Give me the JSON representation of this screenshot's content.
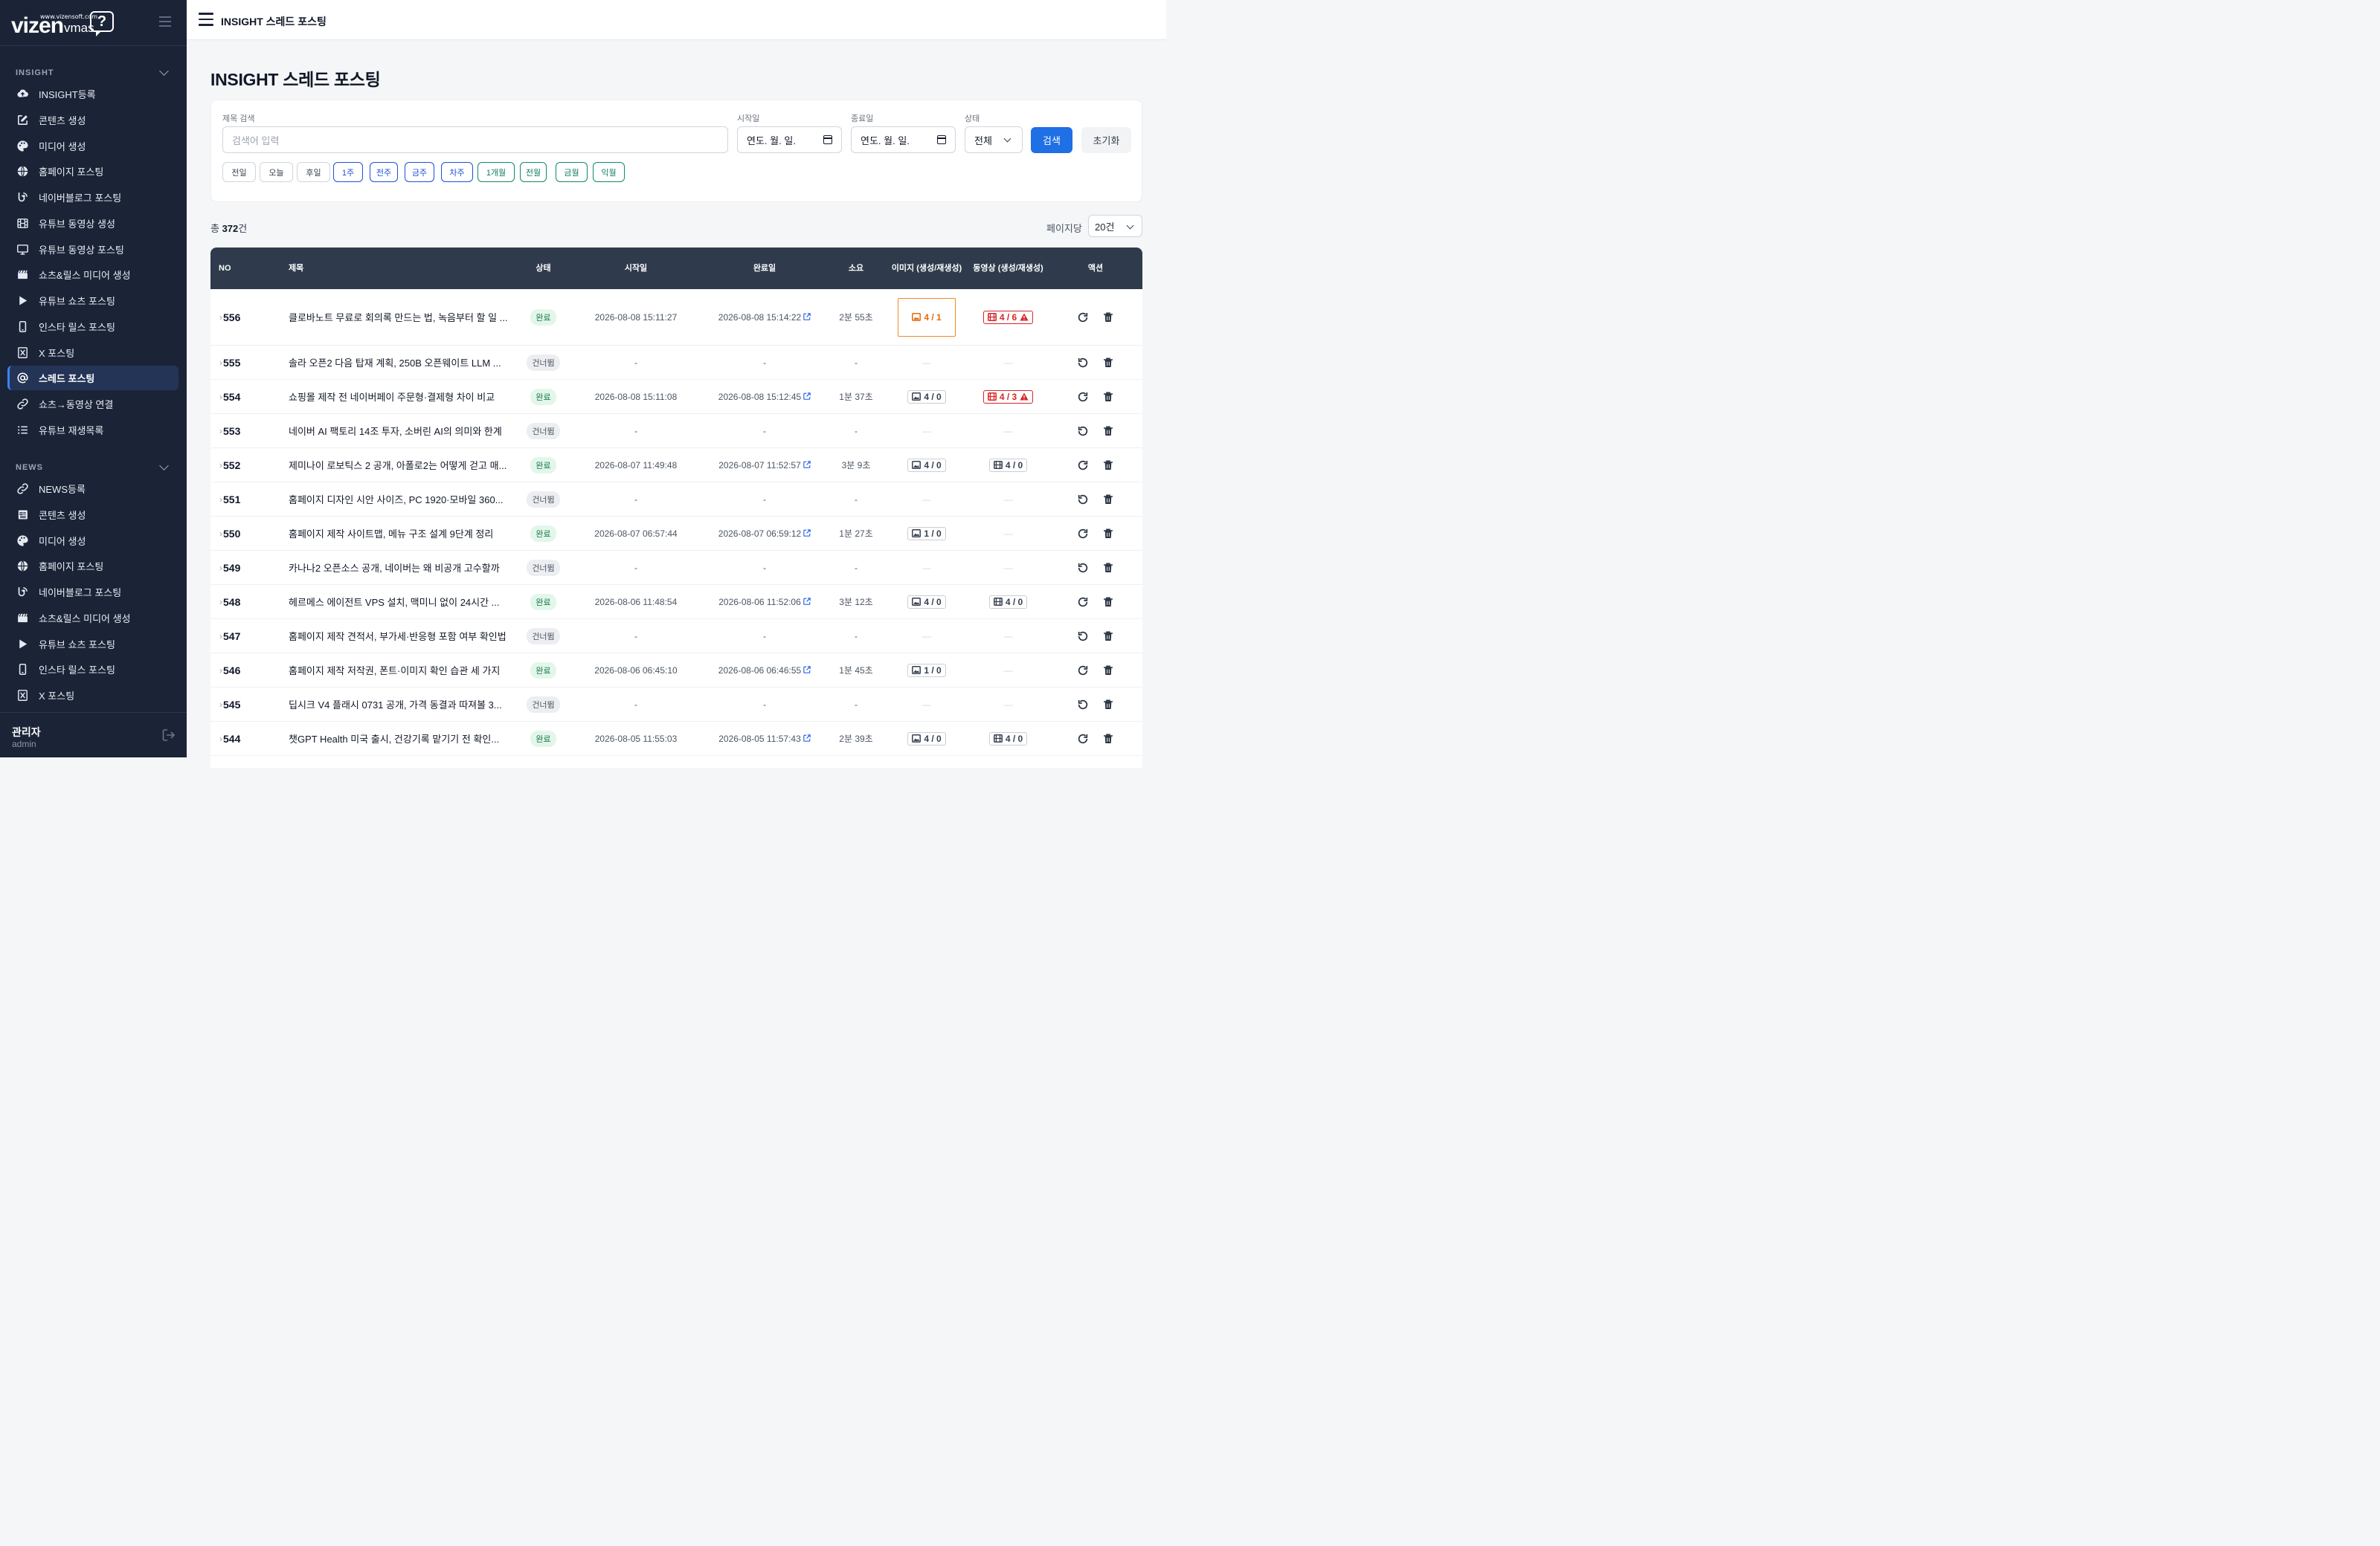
{
  "brand": {
    "url": "www.vizensoft.com",
    "name": "vizen",
    "product": "vmas",
    "mark": "?"
  },
  "sidebar": {
    "sections": [
      {
        "title": "INSIGHT",
        "items": [
          {
            "label": "INSIGHT등록",
            "icon": "cloud-upload-icon"
          },
          {
            "label": "콘텐츠 생성",
            "icon": "edit-icon"
          },
          {
            "label": "미디어 생성",
            "icon": "palette-icon"
          },
          {
            "label": "홈페이지 포스팅",
            "icon": "globe-icon"
          },
          {
            "label": "네이버블로그 포스팅",
            "icon": "blog-icon"
          },
          {
            "label": "유튜브 동영상 생성",
            "icon": "film-icon"
          },
          {
            "label": "유튜브 동영상 포스팅",
            "icon": "monitor-icon"
          },
          {
            "label": "쇼츠&릴스 미디어 생성",
            "icon": "clapper-icon"
          },
          {
            "label": "유튜브 쇼츠 포스팅",
            "icon": "play-icon"
          },
          {
            "label": "인스타 릴스 포스팅",
            "icon": "phone-icon"
          },
          {
            "label": "X 포스팅",
            "icon": "x-icon"
          },
          {
            "label": "스레드 포스팅",
            "icon": "at-icon",
            "active": true
          },
          {
            "label": "쇼츠→동영상 연결",
            "icon": "link-icon"
          },
          {
            "label": "유튜브 재생목록",
            "icon": "list-icon"
          }
        ]
      },
      {
        "title": "NEWS",
        "items": [
          {
            "label": "NEWS등록",
            "icon": "link-icon"
          },
          {
            "label": "콘텐츠 생성",
            "icon": "newspaper-icon"
          },
          {
            "label": "미디어 생성",
            "icon": "palette-icon"
          },
          {
            "label": "홈페이지 포스팅",
            "icon": "globe-icon"
          },
          {
            "label": "네이버블로그 포스팅",
            "icon": "blog-icon"
          },
          {
            "label": "쇼츠&릴스 미디어 생성",
            "icon": "clapper-icon"
          },
          {
            "label": "유튜브 쇼츠 포스팅",
            "icon": "play-icon"
          },
          {
            "label": "인스타 릴스 포스팅",
            "icon": "phone-icon"
          },
          {
            "label": "X 포스팅",
            "icon": "x-icon"
          }
        ]
      }
    ],
    "user": {
      "name": "관리자",
      "id": "admin"
    }
  },
  "topbar": {
    "title": "INSIGHT 스레드 포스팅"
  },
  "page": {
    "title": "INSIGHT 스레드 포스팅"
  },
  "filter": {
    "title_label": "제목 검색",
    "title_placeholder": "검색어 입력",
    "start_label": "시작일",
    "start_value": "연도. 월. 일.",
    "end_label": "종료일",
    "end_value": "연도. 월. 일.",
    "status_label": "상태",
    "status_value": "전체",
    "search_button": "검색",
    "reset_button": "초기화",
    "chips": [
      {
        "label": "전일",
        "style": "gray"
      },
      {
        "label": "오늘",
        "style": "gray"
      },
      {
        "label": "후일",
        "style": "gray"
      },
      {
        "label": "1주",
        "style": "blue"
      },
      {
        "label": "전주",
        "style": "blue"
      },
      {
        "label": "금주",
        "style": "blue"
      },
      {
        "label": "차주",
        "style": "blue"
      },
      {
        "label": "1개월",
        "style": "green"
      },
      {
        "label": "전월",
        "style": "green"
      },
      {
        "label": "금월",
        "style": "green"
      },
      {
        "label": "익월",
        "style": "green"
      }
    ]
  },
  "summary": {
    "prefix": "총 ",
    "count": "372",
    "suffix": "건",
    "per_page_label": "페이지당",
    "per_page_value": "20건"
  },
  "table": {
    "headers": [
      "NO",
      "제목",
      "상태",
      "시작일",
      "완료일",
      "소요",
      "이미지 (생성/재생성)",
      "동영상 (생성/재생성)",
      "액션"
    ],
    "rows": [
      {
        "no": "556",
        "title": "클로바노트 무료로 회의록 만드는 법, 녹음부터 할 일 ...",
        "status": "완료",
        "start": "2026-08-08 15:11:27",
        "end": "2026-08-08 15:14:22",
        "dur": "2분 55초",
        "img": "4 / 1",
        "img_style": "orange",
        "vid": "4 / 6",
        "vid_style": "red"
      },
      {
        "no": "555",
        "title": "솔라 오픈2 다음 탑재 계획, 250B 오픈웨이트 LLM ...",
        "status": "건너뜀",
        "start": "-",
        "end": "-",
        "dur": "-",
        "img": "—",
        "vid": "—"
      },
      {
        "no": "554",
        "title": "쇼핑몰 제작 전 네이버페이 주문형·결제형 차이 비교",
        "status": "완료",
        "start": "2026-08-08 15:11:08",
        "end": "2026-08-08 15:12:45",
        "dur": "1분 37초",
        "img": "4 / 0",
        "img_style": "normal",
        "vid": "4 / 3",
        "vid_style": "red"
      },
      {
        "no": "553",
        "title": "네이버 AI 팩토리 14조 투자, 소버린 AI의 의미와 한계",
        "status": "건너뜀",
        "start": "-",
        "end": "-",
        "dur": "-",
        "img": "—",
        "vid": "—"
      },
      {
        "no": "552",
        "title": "제미나이 로보틱스 2 공개, 아폴로2는 어떻게 걷고 매...",
        "status": "완료",
        "start": "2026-08-07 11:49:48",
        "end": "2026-08-07 11:52:57",
        "dur": "3분 9초",
        "img": "4 / 0",
        "img_style": "normal",
        "vid": "4 / 0",
        "vid_style": "normal"
      },
      {
        "no": "551",
        "title": "홈페이지 디자인 시안 사이즈, PC 1920·모바일 360...",
        "status": "건너뜀",
        "start": "-",
        "end": "-",
        "dur": "-",
        "img": "—",
        "vid": "—"
      },
      {
        "no": "550",
        "title": "홈페이지 제작 사이트맵, 메뉴 구조 설계 9단계 정리",
        "status": "완료",
        "start": "2026-08-07 06:57:44",
        "end": "2026-08-07 06:59:12",
        "dur": "1분 27초",
        "img": "1 / 0",
        "img_style": "normal",
        "vid": "—"
      },
      {
        "no": "549",
        "title": "카나나2 오픈소스 공개, 네이버는 왜 비공개 고수할까",
        "status": "건너뜀",
        "start": "-",
        "end": "-",
        "dur": "-",
        "img": "—",
        "vid": "—"
      },
      {
        "no": "548",
        "title": "헤르메스 에이전트 VPS 설치, 맥미니 없이 24시간 ...",
        "status": "완료",
        "start": "2026-08-06 11:48:54",
        "end": "2026-08-06 11:52:06",
        "dur": "3분 12초",
        "img": "4 / 0",
        "img_style": "normal",
        "vid": "4 / 0",
        "vid_style": "normal"
      },
      {
        "no": "547",
        "title": "홈페이지 제작 견적서, 부가세·반응형 포함 여부 확인법",
        "status": "건너뜀",
        "start": "-",
        "end": "-",
        "dur": "-",
        "img": "—",
        "vid": "—"
      },
      {
        "no": "546",
        "title": "홈페이지 제작 저작권, 폰트·이미지 확인 습관 세 가지",
        "status": "완료",
        "start": "2026-08-06 06:45:10",
        "end": "2026-08-06 06:46:55",
        "dur": "1분 45초",
        "img": "1 / 0",
        "img_style": "normal",
        "vid": "—"
      },
      {
        "no": "545",
        "title": "딥시크 V4 플래시 0731 공개, 가격 동결과 따져볼 3...",
        "status": "건너뜀",
        "start": "-",
        "end": "-",
        "dur": "-",
        "img": "—",
        "vid": "—"
      },
      {
        "no": "544",
        "title": "챗GPT Health 미국 출시, 건강기록 맡기기 전 확인...",
        "status": "완료",
        "start": "2026-08-05 11:55:03",
        "end": "2026-08-05 11:57:43",
        "dur": "2분 39초",
        "img": "4 / 0",
        "img_style": "normal",
        "vid": "4 / 0",
        "vid_style": "normal"
      }
    ]
  }
}
